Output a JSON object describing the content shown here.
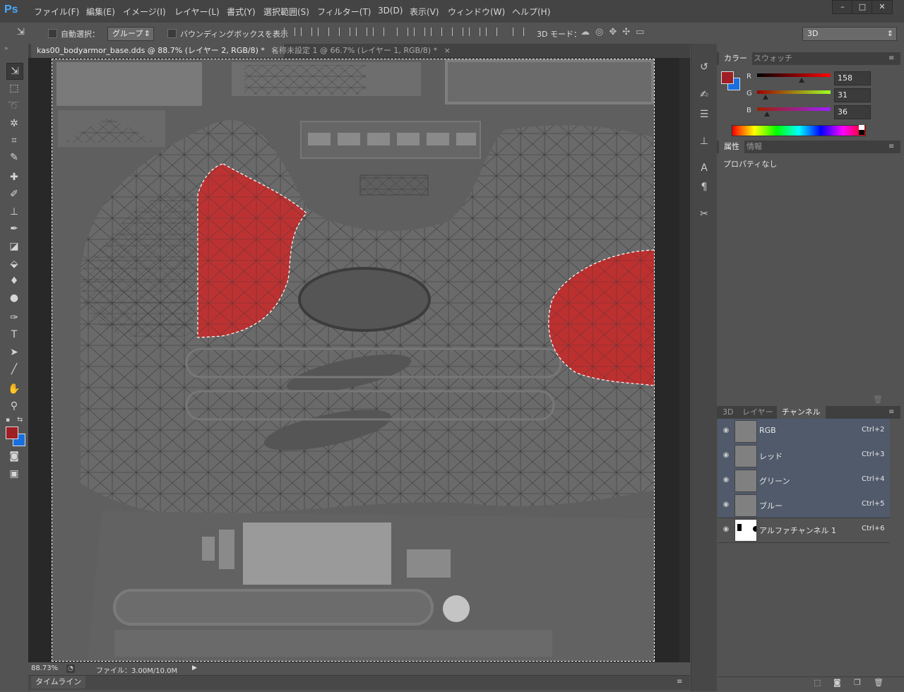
{
  "menu": {
    "logo": "Ps",
    "items": [
      "ファイル(F)",
      "編集(E)",
      "イメージ(I)",
      "レイヤー(L)",
      "書式(Y)",
      "選択範囲(S)",
      "フィルター(T)",
      "3D(D)",
      "表示(V)",
      "ウィンドウ(W)",
      "ヘルプ(H)"
    ],
    "window_controls": [
      "–",
      "□",
      "✕"
    ]
  },
  "options": {
    "auto_select_label": "自動選択：",
    "auto_select_value": "グループ",
    "bounding_box_label": "バウンディングボックスを表示",
    "mode_3d_label": "3D モード：",
    "workspace_value": "3D"
  },
  "tabs": [
    {
      "label": "kas00_bodyarmor_base.dds @ 88.7% (レイヤー 2, RGB/8) *",
      "close": "×"
    },
    {
      "label": "名称未設定 1 @ 66.7% (レイヤー 1, RGB/8) *",
      "close": "×"
    }
  ],
  "status": {
    "zoom": "88.73%",
    "file_info": "ファイル：3.00M/10.0M"
  },
  "timeline": {
    "label": "タイムライン"
  },
  "color_panel": {
    "tabs": [
      "カラー",
      "スウォッチ"
    ],
    "r_label": "R",
    "g_label": "G",
    "b_label": "B",
    "r": "158",
    "g": "31",
    "b": "36",
    "foreground": "#9e1f24",
    "background": "#1a6fe0"
  },
  "properties_panel": {
    "tabs": [
      "属性",
      "情報"
    ],
    "empty_text": "プロパティなし"
  },
  "channels_panel": {
    "tabs": [
      "3D",
      "レイヤー",
      "チャンネル"
    ],
    "rows": [
      {
        "name": "RGB",
        "shortcut": "Ctrl+2"
      },
      {
        "name": "レッド",
        "shortcut": "Ctrl+3"
      },
      {
        "name": "グリーン",
        "shortcut": "Ctrl+4"
      },
      {
        "name": "ブルー",
        "shortcut": "Ctrl+5"
      },
      {
        "name": "アルファチャンネル 1",
        "shortcut": "Ctrl+6"
      }
    ]
  },
  "colors": {
    "selection_fill": "#c72a2a",
    "app_bg": "#535353",
    "menu_bg": "#444444"
  }
}
